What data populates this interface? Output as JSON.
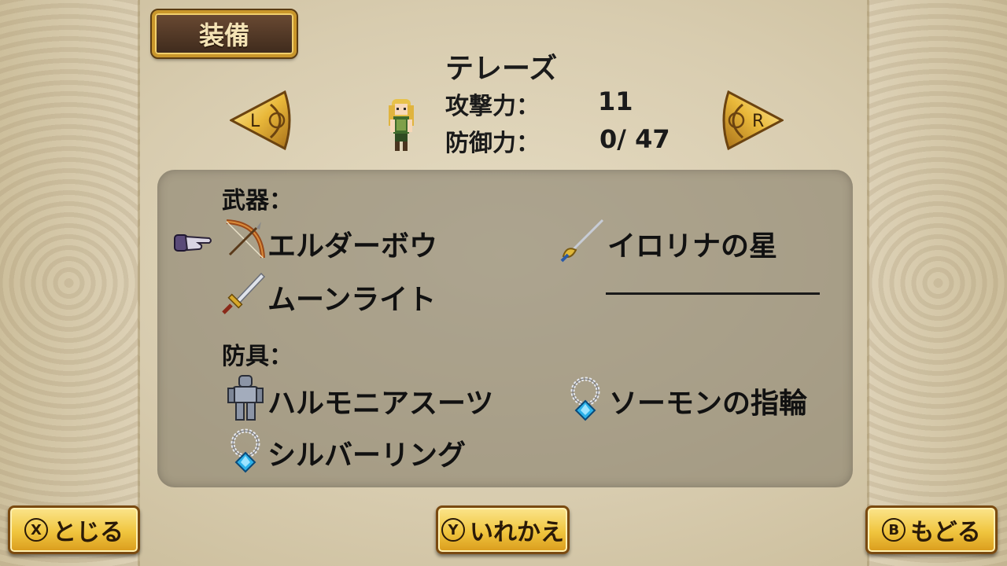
{
  "header": {
    "title": "装備"
  },
  "character": {
    "name": "テレーズ",
    "attack_label": "攻撃力：",
    "attack_value": "11",
    "defense_label": "防御力：",
    "defense_value": "0/ 47",
    "sprite_icon": "character-sprite-icon"
  },
  "nav": {
    "prev_label": "L",
    "next_label": "R"
  },
  "equipment": {
    "weapons_label": "武器：",
    "armor_label": "防具：",
    "weapons": [
      {
        "name": "エルダーボウ",
        "icon": "bow-icon",
        "selected": true
      },
      {
        "name": "イロリナの星",
        "icon": "rapier-icon"
      },
      {
        "name": "ムーンライト",
        "icon": "sword-icon"
      },
      {
        "name": "",
        "icon": "",
        "empty": true
      }
    ],
    "armor": [
      {
        "name": "ハルモニアスーツ",
        "icon": "armor-suit-icon"
      },
      {
        "name": "ソーモンの指輪",
        "icon": "ring-icon"
      },
      {
        "name": "シルバーリング",
        "icon": "ring-icon"
      }
    ]
  },
  "commands": [
    {
      "key": "X",
      "label": "とじる"
    },
    {
      "key": "Y",
      "label": "いれかえ"
    },
    {
      "key": "B",
      "label": "もどる"
    }
  ],
  "colors": {
    "accent_gold": "#f0c53e",
    "plate_brown": "#4e3524",
    "panel_gray": "#7d7664"
  }
}
